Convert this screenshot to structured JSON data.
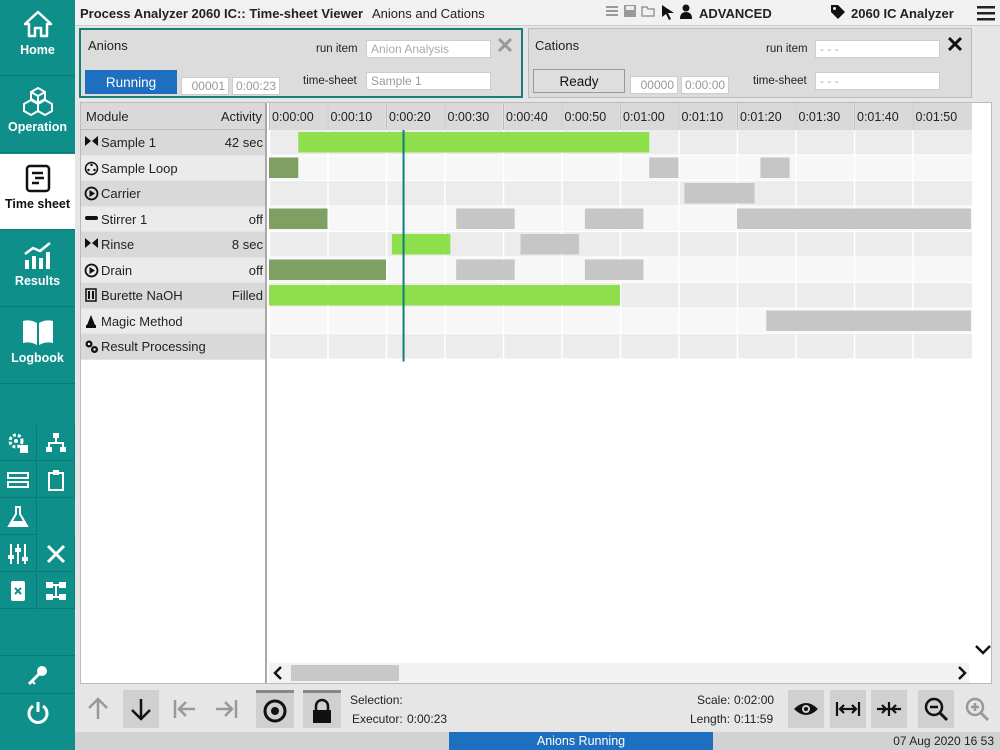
{
  "app": {
    "title": "Process Analyzer 2060 IC:: Time-sheet Viewer",
    "window_title": "Anions and Cations",
    "mode": "ADVANCED",
    "instrument": "2060 IC Analyzer"
  },
  "sidebar": {
    "items": [
      {
        "label": "Home",
        "icon": "home-icon"
      },
      {
        "label": "Operation",
        "icon": "cubes-icon"
      },
      {
        "label": "Time sheet",
        "icon": "timesheet-icon",
        "active": true
      },
      {
        "label": "Results",
        "icon": "chart-icon"
      },
      {
        "label": "Logbook",
        "icon": "book-icon"
      }
    ],
    "tools": [
      "gear-settings-icon",
      "network-icon",
      "transfer-icon",
      "clipboard-icon",
      "flask-icon",
      "sliders-icon",
      "wrench-icon",
      "device-icon",
      "modules-icon"
    ],
    "bottom": [
      "key-icon",
      "power-icon"
    ]
  },
  "panels": {
    "anions": {
      "name": "Anions",
      "run_item_label": "run item",
      "run_item_value": "Anion Analysis",
      "timesheet_label": "time-sheet",
      "timesheet_value": "Sample 1",
      "status": "Running",
      "counter": "00001",
      "time": "0:00:23"
    },
    "cations": {
      "name": "Cations",
      "run_item_label": "run item",
      "run_item_value": "- - -",
      "timesheet_label": "time-sheet",
      "timesheet_value": "- - -",
      "status": "Ready",
      "counter": "00000",
      "time": "0:00:00"
    }
  },
  "gantt": {
    "module_header": "Module",
    "activity_header": "Activity",
    "time_ticks": [
      "0:00:00",
      "0:00:10",
      "0:00:20",
      "0:00:30",
      "0:00:40",
      "0:00:50",
      "0:01:00",
      "0:01:10",
      "0:01:20",
      "0:01:30",
      "0:01:40",
      "0:01:50"
    ],
    "cursor_seconds": 23,
    "modules": [
      {
        "name": "Sample 1",
        "activity": "42 sec",
        "icon": "valve-icon"
      },
      {
        "name": "Sample Loop",
        "activity": "",
        "icon": "loop-icon"
      },
      {
        "name": "Carrier",
        "activity": "",
        "icon": "pump-icon"
      },
      {
        "name": "Stirrer 1",
        "activity": "off",
        "icon": "stirrer-icon"
      },
      {
        "name": "Rinse",
        "activity": "8 sec",
        "icon": "valve-icon"
      },
      {
        "name": "Drain",
        "activity": "off",
        "icon": "pump-icon"
      },
      {
        "name": "Burette NaOH",
        "activity": "Filled",
        "icon": "burette-icon"
      },
      {
        "name": "Magic Method",
        "activity": "",
        "icon": "wizard-icon"
      },
      {
        "name": "Result Processing",
        "activity": "",
        "icon": "gears-icon"
      }
    ],
    "bars": [
      {
        "row": 0,
        "start": 5,
        "end": 65,
        "state": "active"
      },
      {
        "row": 1,
        "start": 0,
        "end": 5,
        "state": "done"
      },
      {
        "row": 1,
        "start": 65,
        "end": 70,
        "state": "pending"
      },
      {
        "row": 1,
        "start": 84,
        "end": 89,
        "state": "pending"
      },
      {
        "row": 2,
        "start": 71,
        "end": 83,
        "state": "pending"
      },
      {
        "row": 3,
        "start": 0,
        "end": 10,
        "state": "done"
      },
      {
        "row": 3,
        "start": 32,
        "end": 42,
        "state": "pending"
      },
      {
        "row": 3,
        "start": 54,
        "end": 64,
        "state": "pending"
      },
      {
        "row": 3,
        "start": 80,
        "end": 120,
        "state": "pending"
      },
      {
        "row": 4,
        "start": 21,
        "end": 31,
        "state": "active"
      },
      {
        "row": 4,
        "start": 43,
        "end": 53,
        "state": "pending"
      },
      {
        "row": 5,
        "start": 0,
        "end": 20,
        "state": "done"
      },
      {
        "row": 5,
        "start": 32,
        "end": 42,
        "state": "pending"
      },
      {
        "row": 5,
        "start": 54,
        "end": 64,
        "state": "pending"
      },
      {
        "row": 6,
        "start": 0,
        "end": 60,
        "state": "active"
      },
      {
        "row": 7,
        "start": 85,
        "end": 120,
        "state": "pending"
      }
    ],
    "colors": {
      "active": "#8fde4b",
      "done": "#7ea163",
      "pending": "#c6c6c6",
      "cursor": "#0f7f7a"
    }
  },
  "footer": {
    "selection_label": "Selection:",
    "executor_label": "Executor:",
    "executor_value": "0:00:23",
    "scale_label": "Scale:",
    "scale_value": "0:02:00",
    "length_label": "Length:",
    "length_value": "0:11:59",
    "status": "Anions Running",
    "datetime": "07 Aug 2020 16 53"
  }
}
